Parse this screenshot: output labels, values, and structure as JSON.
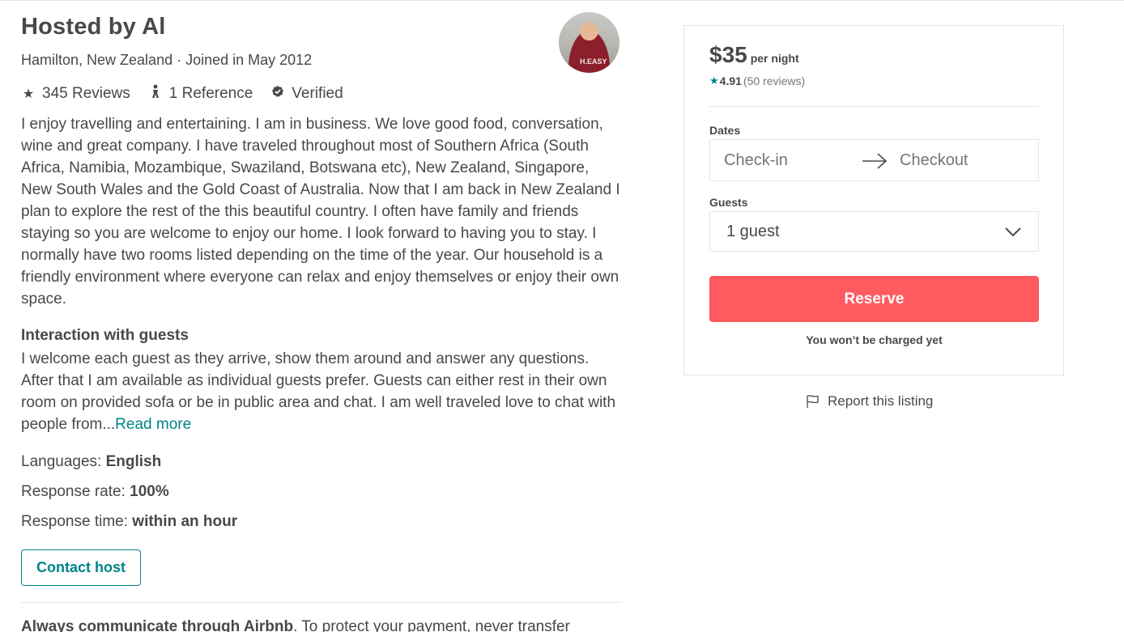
{
  "host": {
    "title": "Hosted by Al",
    "location_joined": "Hamilton, New Zealand · Joined in May 2012",
    "avatar_shirt_text": "H.EASY",
    "stats": {
      "reviews": "345 Reviews",
      "references": "1 Reference",
      "verified": "Verified"
    },
    "about": "I enjoy travelling and entertaining. I am in business. We love good food, conversation, wine and great company. I have traveled throughout most of Southern Africa (South Africa, Namibia, Mozambique, Swaziland, Botswana etc), New Zealand, Singapore, New South Wales and the Gold Coast of Australia. Now that I am back in New Zealand I plan to explore the rest of the this beautiful country. I often have family and friends staying so you are welcome to enjoy our home. I look forward to having you to stay. I normally have two rooms listed depending on the time of the year. Our household is a friendly environment where everyone can relax and enjoy themselves or enjoy their own space.",
    "interaction_title": "Interaction with guests",
    "interaction_text": "I welcome each guest as they arrive, show them around and answer any questions. After that I am available as individual guests prefer. Guests can either rest in their own room on provided sofa or be in public area and chat. I am well traveled love to chat with people from...",
    "read_more": "Read more",
    "languages_label": "Languages: ",
    "languages_value": "English",
    "response_rate_label": "Response rate: ",
    "response_rate_value": "100%",
    "response_time_label": "Response time: ",
    "response_time_value": "within an hour",
    "contact_button": "Contact host",
    "warning_bold": "Always communicate through Airbnb",
    "warning_text": ". To protect your payment, never transfer"
  },
  "booking": {
    "price": "$35",
    "price_unit": "per night",
    "rating_score": "4.91",
    "rating_count": "(50 reviews)",
    "dates_label": "Dates",
    "checkin_placeholder": "Check-in",
    "checkout_placeholder": "Checkout",
    "guests_label": "Guests",
    "guests_value": "1 guest",
    "reserve_button": "Reserve",
    "charged_note": "You won’t be charged yet",
    "report_link": "Report this listing"
  },
  "colors": {
    "accent_teal": "#008489",
    "reserve_red": "#ff5a5f",
    "text_dark": "#484848",
    "text_muted": "#767676",
    "border": "#e4e4e4"
  },
  "icons": [
    "star-icon",
    "reference-icon",
    "verified-icon",
    "arrow-right-icon",
    "chevron-down-icon",
    "flag-icon"
  ]
}
